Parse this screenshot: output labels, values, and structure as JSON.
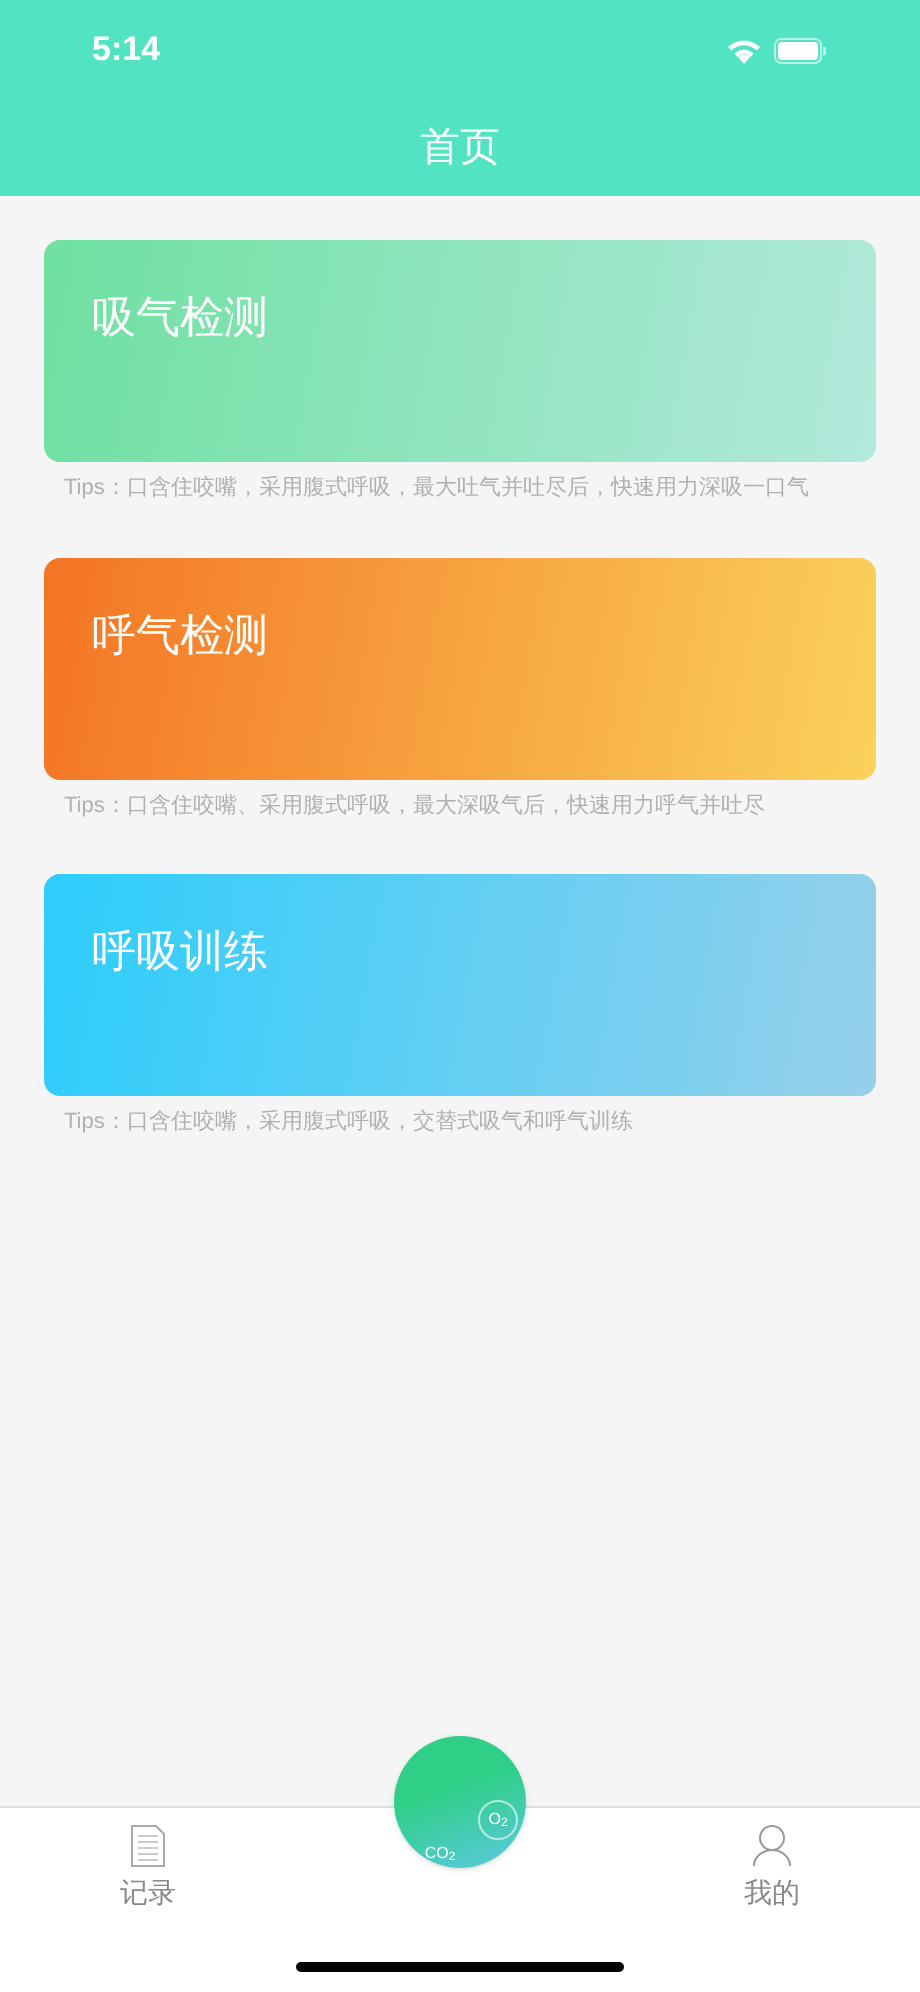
{
  "status_bar": {
    "time": "5:14"
  },
  "header": {
    "title": "首页"
  },
  "cards": [
    {
      "title": "吸气检测",
      "tips": "Tips：口含住咬嘴，采用腹式呼吸，最大吐气并吐尽后，快速用力深吸一口气",
      "color": "#6ee0a0"
    },
    {
      "title": "呼气检测",
      "tips": "Tips：口含住咬嘴、采用腹式呼吸，最大深吸气后，快速用力呼气并吐尽",
      "color": "#f47424"
    },
    {
      "title": "呼吸训练",
      "tips": "Tips：口含住咬嘴，采用腹式呼吸，交替式吸气和呼气训练",
      "color": "#2ccdfc"
    }
  ],
  "tab_bar": {
    "left": "记录",
    "center_labels": [
      "O$_{2}$",
      "CO$_{2}$"
    ],
    "right": "我的"
  }
}
